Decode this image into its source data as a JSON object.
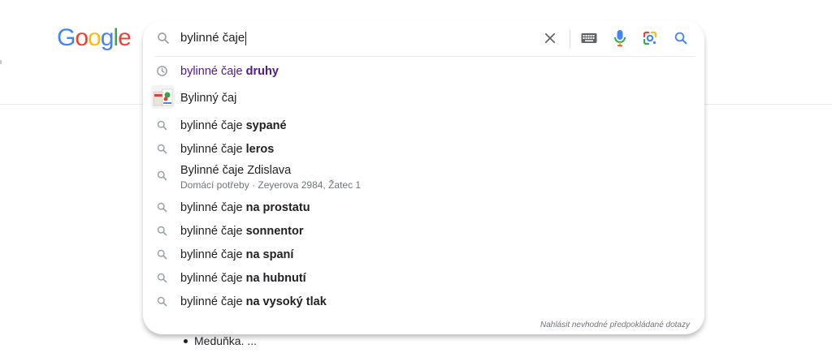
{
  "logo": {
    "letters": [
      {
        "char": "G",
        "color": "#4285F4"
      },
      {
        "char": "o",
        "color": "#EA4335"
      },
      {
        "char": "o",
        "color": "#FBBC05"
      },
      {
        "char": "g",
        "color": "#4285F4"
      },
      {
        "char": "l",
        "color": "#34A853"
      },
      {
        "char": "e",
        "color": "#EA4335"
      }
    ]
  },
  "search": {
    "query": "bylinné čaje",
    "icons": {
      "lead": "search-icon",
      "clear": "close-icon",
      "keyboard": "keyboard-icon",
      "voice": "microphone-icon",
      "lens": "lens-camera-icon",
      "submit": "search-icon"
    }
  },
  "suggestions": [
    {
      "kind": "history",
      "icon": "history-clock-icon",
      "prefix": "bylinné čaje ",
      "bold": "druhy"
    },
    {
      "kind": "entity",
      "icon": "thumbnail",
      "prefix": "Bylinný čaj",
      "bold": ""
    },
    {
      "kind": "query",
      "icon": "search-icon",
      "prefix": "bylinné čaje ",
      "bold": "sypané"
    },
    {
      "kind": "query",
      "icon": "search-icon",
      "prefix": "bylinné čaje ",
      "bold": "leros"
    },
    {
      "kind": "place",
      "icon": "search-icon",
      "prefix": "Bylinné čaje Zdislava",
      "bold": "",
      "sub": "Domácí potřeby · Zeyerova 2984, Žatec 1"
    },
    {
      "kind": "query",
      "icon": "search-icon",
      "prefix": "bylinné čaje ",
      "bold": "na prostatu"
    },
    {
      "kind": "query",
      "icon": "search-icon",
      "prefix": "bylinné čaje ",
      "bold": "sonnentor"
    },
    {
      "kind": "query",
      "icon": "search-icon",
      "prefix": "bylinné čaje ",
      "bold": "na spaní"
    },
    {
      "kind": "query",
      "icon": "search-icon",
      "prefix": "bylinné čaje ",
      "bold": "na hubnutí"
    },
    {
      "kind": "query",
      "icon": "search-icon",
      "prefix": "bylinné čaje ",
      "bold": "na vysoký tlak"
    }
  ],
  "report_link": "Nahlásit nevhodné předpokládané dotazy",
  "background_content": {
    "list_item": "Meduňka. ..."
  },
  "colors": {
    "history_text": "#52188c",
    "icon_gray": "#9aa0a6",
    "blue": "#4285F4",
    "red": "#EA4335",
    "yellow": "#FBBC05",
    "green": "#34A853"
  }
}
